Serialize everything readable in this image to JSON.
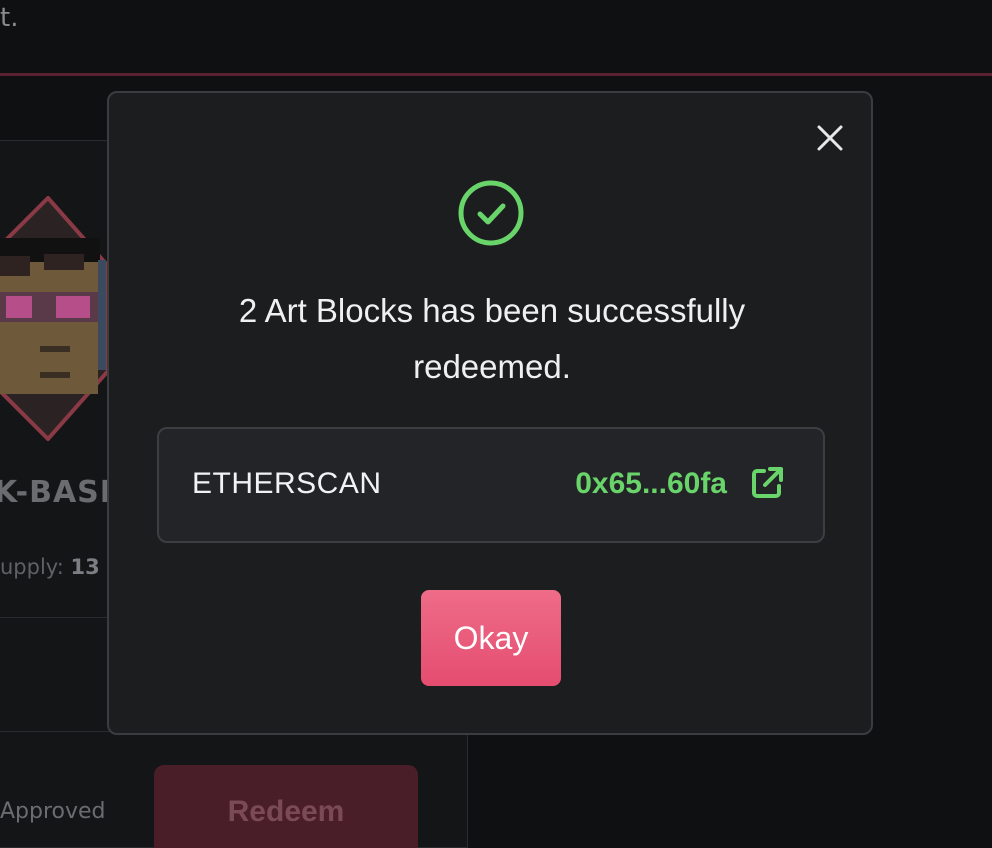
{
  "background": {
    "top_text": "t.",
    "card": {
      "name": "K-BASIC",
      "supply_label": "upply:",
      "supply_value": "13",
      "approved_label": "Approved",
      "redeem_label": "Redeem"
    }
  },
  "modal": {
    "close_icon": "close-icon",
    "status_icon": "check-circle-icon",
    "message_line1": "2 Art Blocks has been successfully",
    "message_line2": "redeemed.",
    "explorer_label": "ETHERSCAN",
    "tx_hash": "0x65...60fa",
    "external_link_icon": "external-link-icon",
    "okay_label": "Okay"
  },
  "colors": {
    "accent_green": "#69d46a",
    "primary_pink": "#e85a7a",
    "modal_bg": "#1c1d1f"
  }
}
